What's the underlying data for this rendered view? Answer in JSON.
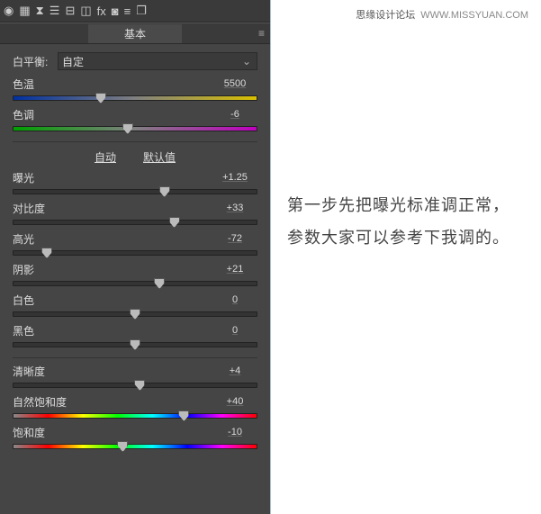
{
  "toolbar_icons": [
    "aperture",
    "grid",
    "mirror",
    "rows",
    "tone",
    "split",
    "fx",
    "camera",
    "sliders",
    "layers"
  ],
  "tab": "基本",
  "wb": {
    "label": "白平衡:",
    "value": "自定"
  },
  "temp": {
    "label": "色温",
    "value": "5500",
    "pos": 36
  },
  "tint": {
    "label": "色调",
    "value": "-6",
    "pos": 47
  },
  "auto": "自动",
  "default": "默认值",
  "exposure": {
    "label": "曝光",
    "value": "+1.25",
    "pos": 62
  },
  "contrast": {
    "label": "对比度",
    "value": "+33",
    "pos": 66
  },
  "highlights": {
    "label": "高光",
    "value": "-72",
    "pos": 14
  },
  "shadows": {
    "label": "阴影",
    "value": "+21",
    "pos": 60
  },
  "whites": {
    "label": "白色",
    "value": "0",
    "pos": 50
  },
  "blacks": {
    "label": "黑色",
    "value": "0",
    "pos": 50
  },
  "clarity": {
    "label": "清晰度",
    "value": "+4",
    "pos": 52
  },
  "vibrance": {
    "label": "自然饱和度",
    "value": "+40",
    "pos": 70
  },
  "saturation": {
    "label": "饱和度",
    "value": "-10",
    "pos": 45
  },
  "watermark": {
    "site": "思缘设计论坛",
    "url": "WWW.MISSYUAN.COM"
  },
  "instruction": "第一步先把曝光标准调正常，参数大家可以参考下我调的。"
}
